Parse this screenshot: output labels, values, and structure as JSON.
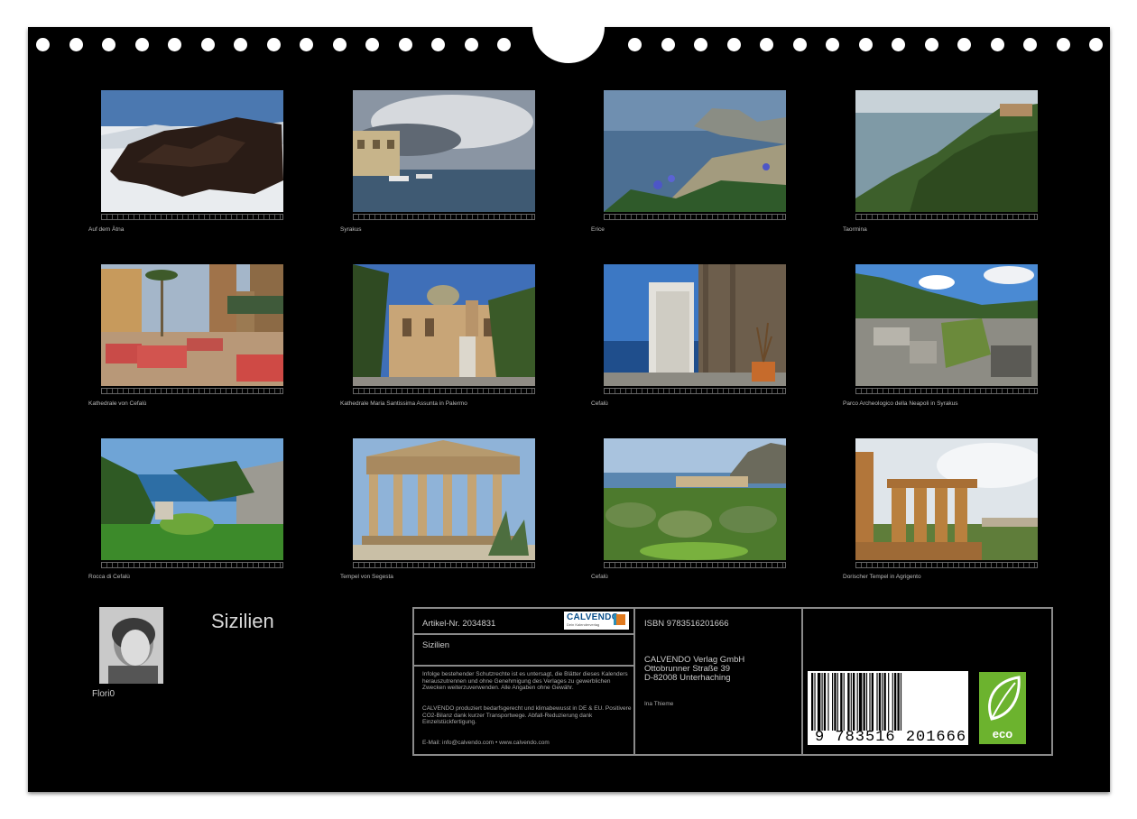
{
  "calendar": {
    "title": "Sizilien",
    "author": "Flori0"
  },
  "photos": [
    {
      "caption": "Auf dem Ätna",
      "icon": "etna-lava-snow"
    },
    {
      "caption": "Syrakus",
      "icon": "syracuse-harbour"
    },
    {
      "caption": "Erice",
      "icon": "erice-coast"
    },
    {
      "caption": "Taormina",
      "icon": "taormina-coast"
    },
    {
      "caption": "Kathedrale von Cefalù",
      "icon": "cefalu-piazza"
    },
    {
      "caption": "Kathedrale Maria Santissima Assunta in Palermo",
      "icon": "palermo-cathedral"
    },
    {
      "caption": "Cefalù",
      "icon": "cefalu-stairs-sea"
    },
    {
      "caption": "Parco Archeologico della Neapoli in Syrakus",
      "icon": "neapoli-ruins"
    },
    {
      "caption": "Rocca di Cefalù",
      "icon": "rocca-garden"
    },
    {
      "caption": "Tempel von Segesta",
      "icon": "segesta-temple"
    },
    {
      "caption": "Cefalù",
      "icon": "cefalu-olive-grove"
    },
    {
      "caption": "Dorischer Tempel in Agrigento",
      "icon": "agrigento-temple"
    }
  ],
  "info": {
    "article": "Artikel-Nr. 2034831",
    "name": "Sizilien",
    "logo_text": "CALVENDO",
    "logo_sub": "Dein Kalenderverlag",
    "disclaimer": "Infolge bestehender Schutzrechte ist es untersagt, die Blätter dieses Kalenders herauszutrennen und ohne Genehmigung des Verlages zu gewerblichen Zwecken weiterzuverwenden. Alle Angaben ohne Gewähr.",
    "eco_text": "CALVENDO produziert bedarfsgerecht und klimabewusst in DE & EU. Positivere CO2-Bilanz dank kurzer Transportwege. Abfall-Reduzierung dank Einzelstückfertigung.",
    "contact": "E-Mail: info@calvendo.com • www.calvendo.com",
    "isbn": "ISBN 9783516201666",
    "publisher": "CALVENDO Verlag GmbH",
    "street": "Ottobrunner Straße 39",
    "city": "D-82008 Unterhaching",
    "person": "Ina Thieme",
    "barcode_number": "9 783516 201666",
    "eco_label": "eco"
  },
  "colors": {
    "background": "#000000",
    "frame": "#8a8a8a",
    "eco_green": "#6cb32e"
  }
}
